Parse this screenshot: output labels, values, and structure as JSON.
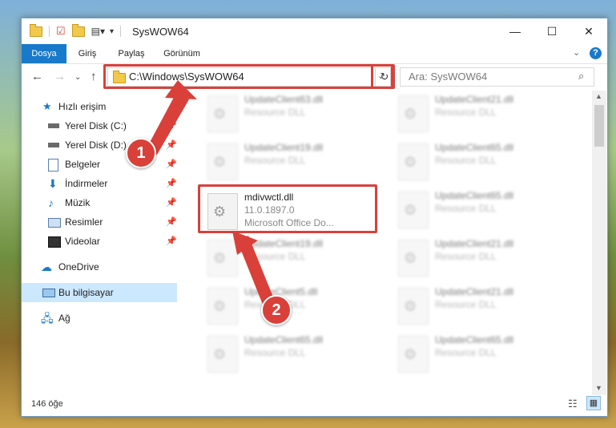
{
  "window": {
    "title": "SysWOW64",
    "minimize": "—",
    "maximize": "☐",
    "close": "✕"
  },
  "ribbon": {
    "tabs": [
      "Dosya",
      "Giriş",
      "Paylaş",
      "Görünüm"
    ]
  },
  "address": {
    "path": "C:\\Windows\\SysWOW64",
    "search_placeholder": "Ara: SysWOW64"
  },
  "sidebar": {
    "items": [
      {
        "label": "Hızlı erişim",
        "icon": "star-icon",
        "pinned": false
      },
      {
        "label": "Yerel Disk (C:)",
        "icon": "drive-icon",
        "pinned": true
      },
      {
        "label": "Yerel Disk (D:)",
        "icon": "drive-icon",
        "pinned": true
      },
      {
        "label": "Belgeler",
        "icon": "documents-icon",
        "pinned": true
      },
      {
        "label": "İndirmeler",
        "icon": "download-icon",
        "pinned": true
      },
      {
        "label": "Müzik",
        "icon": "music-icon",
        "pinned": true
      },
      {
        "label": "Resimler",
        "icon": "pictures-icon",
        "pinned": true
      },
      {
        "label": "Videolar",
        "icon": "videos-icon",
        "pinned": true
      },
      {
        "label": "OneDrive",
        "icon": "cloud-icon",
        "pinned": false
      },
      {
        "label": "Bu bilgisayar",
        "icon": "computer-icon",
        "pinned": false
      },
      {
        "label": "Ağ",
        "icon": "network-icon",
        "pinned": false
      }
    ]
  },
  "files": [
    {
      "name": "UpdateClient63.dll",
      "line2": "Resource DLL",
      "line3": ""
    },
    {
      "name": "UpdateClient21.dll",
      "line2": "Resource DLL",
      "line3": ""
    },
    {
      "name": "UpdateClient19.dll",
      "line2": "Resource DLL",
      "line3": ""
    },
    {
      "name": "UpdateClient65.dll",
      "line2": "Resource DLL",
      "line3": ""
    },
    {
      "name": "mdivwctl.dll",
      "line2": "11.0.1897.0",
      "line3": "Microsoft Office Do..."
    },
    {
      "name": "UpdateClient65.dll",
      "line2": "Resource DLL",
      "line3": ""
    },
    {
      "name": "UpdateClient19.dll",
      "line2": "Resource DLL",
      "line3": ""
    },
    {
      "name": "UpdateClient21.dll",
      "line2": "Resource DLL",
      "line3": ""
    },
    {
      "name": "UpdateClient5.dll",
      "line2": "Resource DLL",
      "line3": ""
    },
    {
      "name": "UpdateClient21.dll",
      "line2": "Resource DLL",
      "line3": ""
    },
    {
      "name": "UpdateClient65.dll",
      "line2": "Resource DLL",
      "line3": ""
    },
    {
      "name": "UpdateClient65.dll",
      "line2": "Resource DLL",
      "line3": ""
    }
  ],
  "status": {
    "item_count": "146 öğe"
  },
  "callouts": [
    "1",
    "2"
  ],
  "colors": {
    "accent": "#1979ca",
    "highlight": "#d9403a",
    "selection": "#cce8ff"
  }
}
